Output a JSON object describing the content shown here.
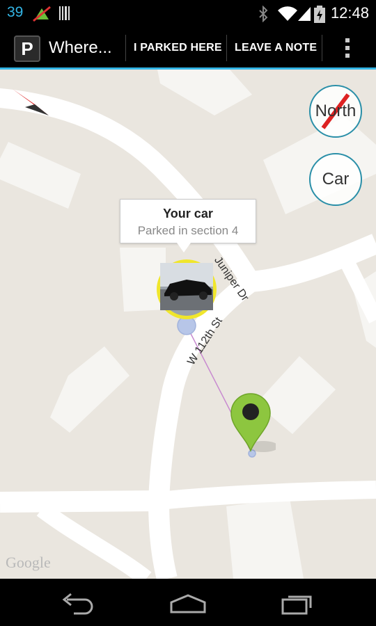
{
  "status_bar": {
    "notification_count": "39",
    "time": "12:48",
    "icons": [
      "location-icon",
      "barcode-icon",
      "bluetooth-icon",
      "wifi-icon",
      "cell-signal-icon",
      "battery-icon"
    ]
  },
  "action_bar": {
    "app_icon_letter": "P",
    "title": "Where...",
    "parked_here_label": "I PARKED HERE",
    "leave_note_label": "LEAVE A NOTE"
  },
  "map": {
    "north_button_label": "North",
    "car_button_label": "Car",
    "car_bubble": {
      "title": "Your car",
      "subtitle": "Parked in section 4"
    },
    "streets": [
      "W 112th St",
      "Juniper Dr"
    ],
    "attribution": "Google"
  },
  "colors": {
    "accent": "#33b5e5",
    "pin_green": "#8dc63f",
    "car_ring": "#f0e62c"
  }
}
